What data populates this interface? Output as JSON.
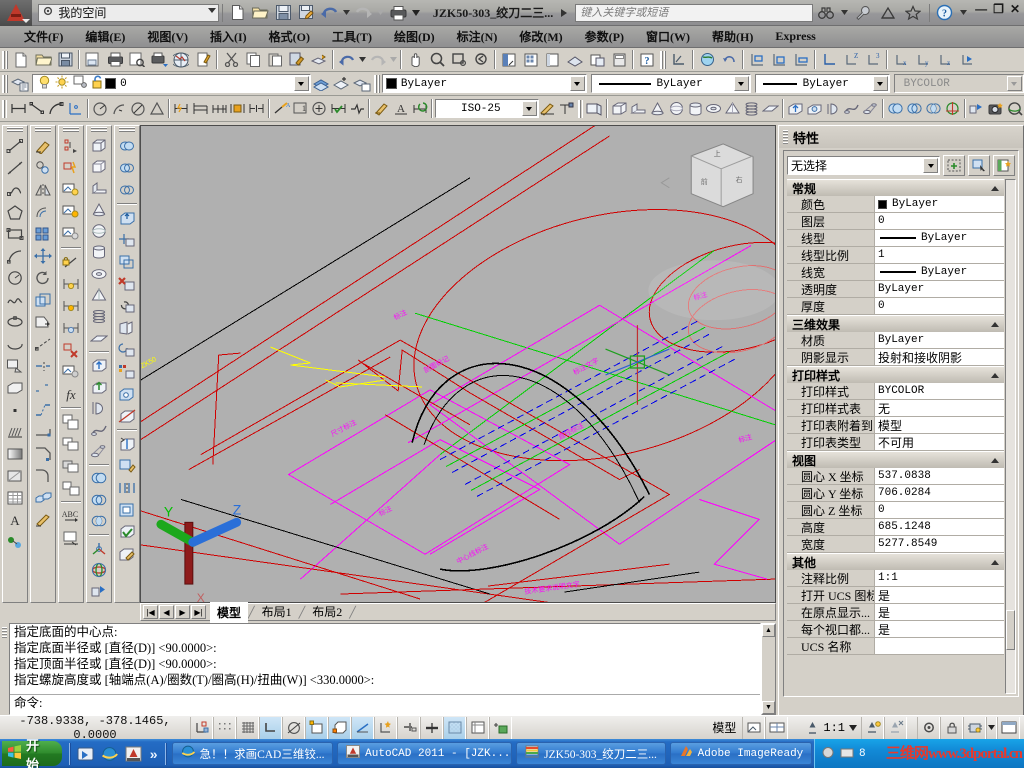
{
  "titlebar": {
    "workspace": "我的空间",
    "doc_title": "JZK50-303_绞刀二三...",
    "search_placeholder": "键入关键字或短语",
    "quick_access": [
      {
        "name": "new-icon",
        "label": "新建"
      },
      {
        "name": "open-icon",
        "label": "打开"
      },
      {
        "name": "save-icon",
        "label": "保存"
      },
      {
        "name": "saveas-icon",
        "label": "另存为"
      },
      {
        "name": "undo-icon",
        "label": "放弃"
      },
      {
        "name": "redo-icon",
        "label": "重做"
      },
      {
        "name": "plot-icon",
        "label": "打印"
      }
    ],
    "right_icons": [
      {
        "name": "search-binoculars-icon",
        "label": "搜索"
      },
      {
        "name": "wrench-icon",
        "label": "通讯中心"
      },
      {
        "name": "satellite-icon",
        "label": "收藏夹"
      },
      {
        "name": "star-icon",
        "label": "收藏"
      },
      {
        "name": "help-icon",
        "label": "帮助"
      }
    ],
    "window_controls": [
      "—",
      "❐",
      "✕"
    ]
  },
  "menubar": {
    "items": [
      "文件(F)",
      "编辑(E)",
      "视图(V)",
      "插入(I)",
      "格式(O)",
      "工具(T)",
      "绘图(D)",
      "标注(N)",
      "修改(M)",
      "参数(P)",
      "窗口(W)",
      "帮助(H)",
      "Express"
    ]
  },
  "toolbars": {
    "layer_value": "0",
    "color_value": "ByLayer",
    "linetype_value": "ByLayer",
    "lineweight_value": "ByLayer",
    "plotstyle_value": "BYCOLOR",
    "dimstyle_value": "ISO-25"
  },
  "canvas": {
    "tabs": [
      {
        "label": "模型",
        "active": true
      },
      {
        "label": "布局1",
        "active": false
      },
      {
        "label": "布局2",
        "active": false
      }
    ],
    "ucs_axes": [
      {
        "label": "X",
        "color": "#aa1414"
      },
      {
        "label": "Y",
        "color": "#00b300"
      },
      {
        "label": "Z",
        "color": "#1a6ee0"
      }
    ],
    "viewcube_faces": [
      "前",
      "上",
      "右"
    ],
    "background": "#b0b0b0"
  },
  "properties": {
    "title": "特性",
    "selection": "无选择",
    "tool_buttons": [
      {
        "name": "quick-select-icon"
      },
      {
        "name": "select-objects-icon"
      },
      {
        "name": "pickadd-icon"
      }
    ],
    "categories": [
      {
        "name": "常规",
        "rows": [
          {
            "label": "颜色",
            "value": "ByLayer",
            "swatch": "#000000"
          },
          {
            "label": "图层",
            "value": "0"
          },
          {
            "label": "线型",
            "value": "ByLayer",
            "line": true
          },
          {
            "label": "线型比例",
            "value": "1"
          },
          {
            "label": "线宽",
            "value": "ByLayer",
            "line": true
          },
          {
            "label": "透明度",
            "value": "ByLayer"
          },
          {
            "label": "厚度",
            "value": "0"
          }
        ]
      },
      {
        "name": "三维效果",
        "rows": [
          {
            "label": "材质",
            "value": "ByLayer"
          },
          {
            "label": "阴影显示",
            "value": "投射和接收阴影",
            "cn": true
          }
        ]
      },
      {
        "name": "打印样式",
        "rows": [
          {
            "label": "打印样式",
            "value": "BYCOLOR"
          },
          {
            "label": "打印样式表",
            "value": "无",
            "cn": true
          },
          {
            "label": "打印表附着到",
            "value": "模型",
            "cn": true
          },
          {
            "label": "打印表类型",
            "value": "不可用",
            "cn": true
          }
        ]
      },
      {
        "name": "视图",
        "rows": [
          {
            "label": "圆心 X 坐标",
            "value": "537.0838"
          },
          {
            "label": "圆心 Y 坐标",
            "value": "706.0284"
          },
          {
            "label": "圆心 Z 坐标",
            "value": "0"
          },
          {
            "label": "高度",
            "value": "685.1248"
          },
          {
            "label": "宽度",
            "value": "5277.8549"
          }
        ]
      },
      {
        "name": "其他",
        "rows": [
          {
            "label": "注释比例",
            "value": "1:1"
          },
          {
            "label": "打开 UCS 图标",
            "value": "是",
            "cn": true
          },
          {
            "label": "在原点显示...",
            "value": "是",
            "cn": true
          },
          {
            "label": "每个视口都...",
            "value": "是",
            "cn": true
          },
          {
            "label": "UCS 名称",
            "value": ""
          }
        ]
      }
    ]
  },
  "command_window": {
    "history": [
      "指定底面的中心点:",
      "指定底面半径或 [直径(D)] <90.0000>:",
      "指定顶面半径或 [直径(D)] <90.0000>:",
      "指定螺旋高度或 [轴端点(A)/圈数(T)/圈高(H)/扭曲(W)] <330.0000>:"
    ],
    "prompt": "命令:"
  },
  "statusbar": {
    "coordinates": "-738.9338,  -378.1465,  0.0000",
    "toggles": [
      {
        "name": "snap-mode-toggle",
        "label": "捕捉",
        "on": false
      },
      {
        "name": "grid-display-toggle",
        "label": "栅格",
        "on": false
      },
      {
        "name": "grid-mode-toggle",
        "label": "栅格模式",
        "on": false
      },
      {
        "name": "ortho-mode-toggle",
        "label": "正交",
        "on": true
      },
      {
        "name": "polar-tracking-toggle",
        "label": "极轴",
        "on": false
      },
      {
        "name": "object-snap-toggle",
        "label": "对象捕捉",
        "on": true
      },
      {
        "name": "3dosnap-toggle",
        "label": "三维对象捕捉",
        "on": true
      },
      {
        "name": "object-snap-tracking-toggle",
        "label": "对象追踪",
        "on": true
      },
      {
        "name": "ucs-tracking-toggle",
        "label": "允许/禁止动态UCS",
        "on": false
      },
      {
        "name": "dynamic-input-toggle",
        "label": "动态输入",
        "on": false
      },
      {
        "name": "lineweight-toggle",
        "label": "线宽",
        "on": false
      },
      {
        "name": "transparency-toggle",
        "label": "透明度",
        "on": true
      },
      {
        "name": "quick-properties-toggle",
        "label": "快捷特性",
        "on": false
      },
      {
        "name": "selection-cycling-toggle",
        "label": "选择循环",
        "on": false
      }
    ],
    "space_label": "模型",
    "annotation_scale": "1:1",
    "right_icons": [
      {
        "name": "model-space-icon"
      },
      {
        "name": "viewport-icon"
      },
      {
        "name": "annotation-scale-icon"
      },
      {
        "name": "annotation-visibility-icon"
      },
      {
        "name": "annotation-auto-add-icon"
      },
      {
        "name": "workspace-gear-icon"
      },
      {
        "name": "toolbar-lock-icon"
      },
      {
        "name": "hardware-accel-icon"
      },
      {
        "name": "clean-screen-icon"
      }
    ]
  },
  "taskbar": {
    "start_label": "开始",
    "quick_launch": [
      {
        "name": "show-desktop-icon"
      },
      {
        "name": "internet-explorer-icon"
      },
      {
        "name": "autocad-quicklaunch-icon"
      }
    ],
    "overflow": "»",
    "tasks": [
      {
        "name": "browser-task",
        "label": "急！！求画CAD三维铰...",
        "icon": "ie-icon"
      },
      {
        "name": "autocad-task",
        "label": "AutoCAD 2011 - [JZK...",
        "icon": "acad-icon"
      },
      {
        "name": "autocad-doc-task",
        "label": "JZK50-303_绞刀二三...",
        "icon": "doc-icon"
      },
      {
        "name": "imageready-task",
        "label": "Adobe ImageReady",
        "icon": "ir-icon"
      }
    ],
    "tray_time": "8",
    "watermark_cn": "三维网",
    "watermark_en": "www.3dportal.cn"
  }
}
